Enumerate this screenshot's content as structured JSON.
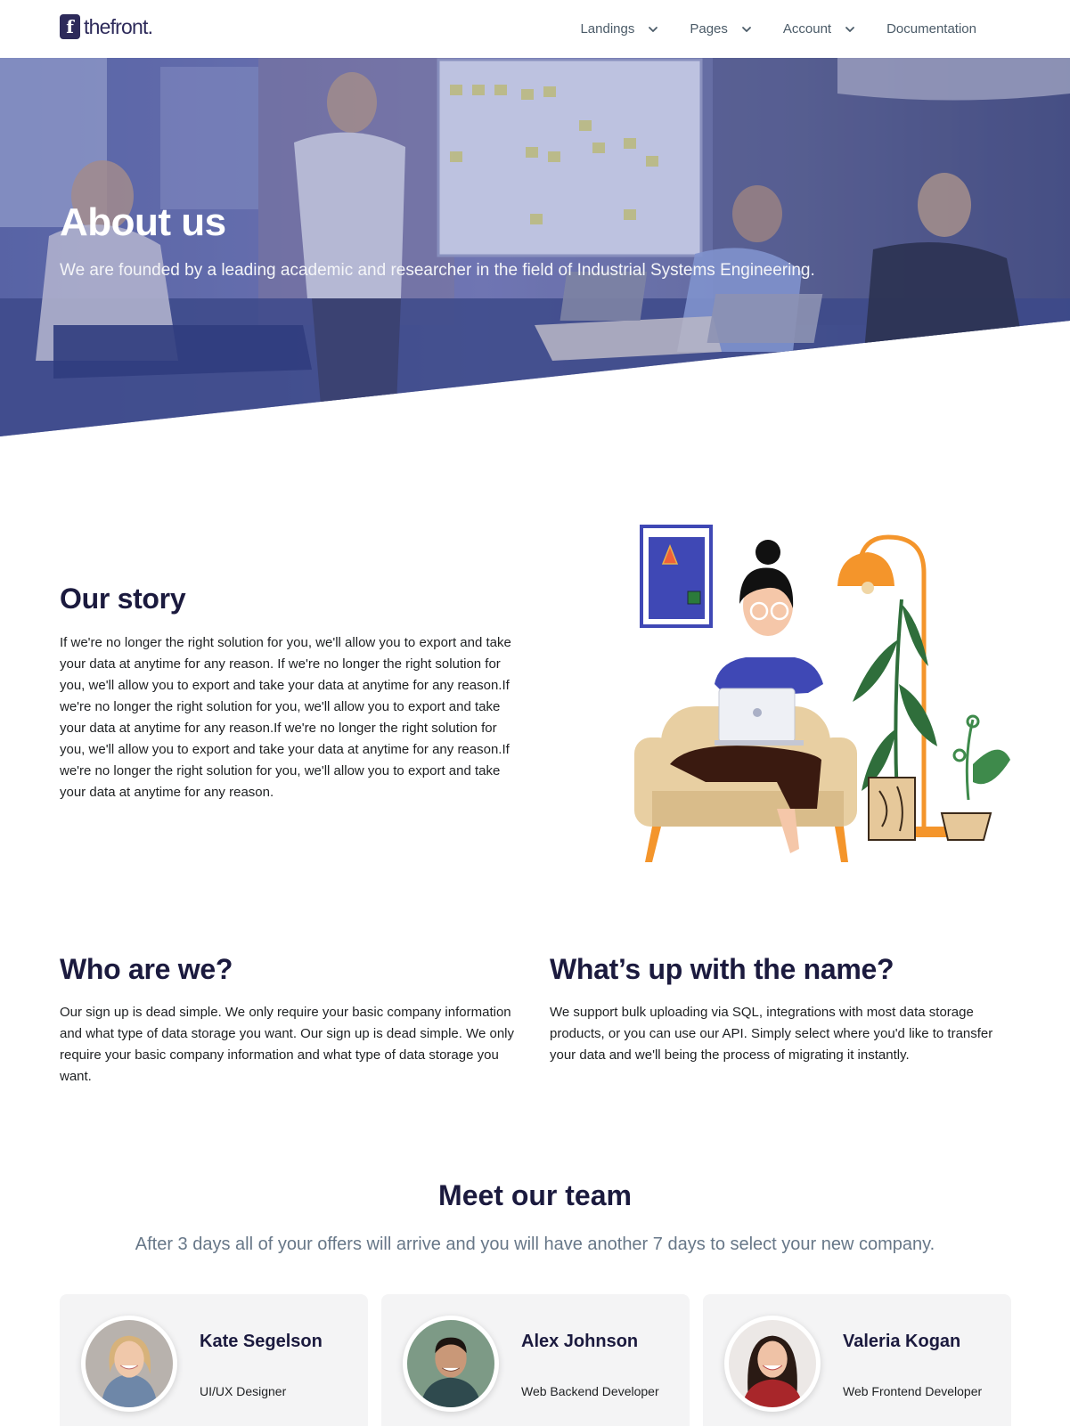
{
  "brand": {
    "logo_letter": "f",
    "name": "thefront."
  },
  "nav": {
    "items": [
      {
        "label": "Landings",
        "dropdown": true
      },
      {
        "label": "Pages",
        "dropdown": true
      },
      {
        "label": "Account",
        "dropdown": true
      },
      {
        "label": "Documentation",
        "dropdown": false
      }
    ]
  },
  "hero": {
    "title": "About us",
    "subtitle": "We are founded by a leading academic and researcher in the field of Industrial Systems Engineering."
  },
  "story": {
    "title": "Our story",
    "text": "If we're no longer the right solution for you, we'll allow you to export and take your data at anytime for any reason. If we're no longer the right solution for you, we'll allow you to export and take your data at anytime for any reason.If we're no longer the right solution for you, we'll allow you to export and take your data at anytime for any reason.If we're no longer the right solution for you, we'll allow you to export and take your data at anytime for any reason.If we're no longer the right solution for you, we'll allow you to export and take your data at anytime for any reason."
  },
  "who": {
    "title": "Who are we?",
    "text": "Our sign up is dead simple. We only require your basic company information and what type of data storage you want. Our sign up is dead simple. We only require your basic company information and what type of data storage you want."
  },
  "name_section": {
    "title": "What’s up with the name?",
    "text": "We support bulk uploading via SQL, integrations with most data storage products, or you can use our API. Simply select where you'd like to transfer your data and we'll being the process of migrating it instantly."
  },
  "team": {
    "title": "Meet our team",
    "subtitle": "After 3 days all of your offers will arrive and you will have another 7 days to select your new company.",
    "members": [
      {
        "name": "Kate Segelson",
        "role": "UI/UX Designer"
      },
      {
        "name": "Alex Johnson",
        "role": "Web Backend Developer"
      },
      {
        "name": "Valeria Kogan",
        "role": "Web Frontend Developer"
      }
    ]
  },
  "colors": {
    "brand_dark": "#1b1a3e",
    "hero_overlay": "#4a52a0",
    "nav_text": "#4b5b68",
    "card_bg": "#f4f4f5"
  }
}
